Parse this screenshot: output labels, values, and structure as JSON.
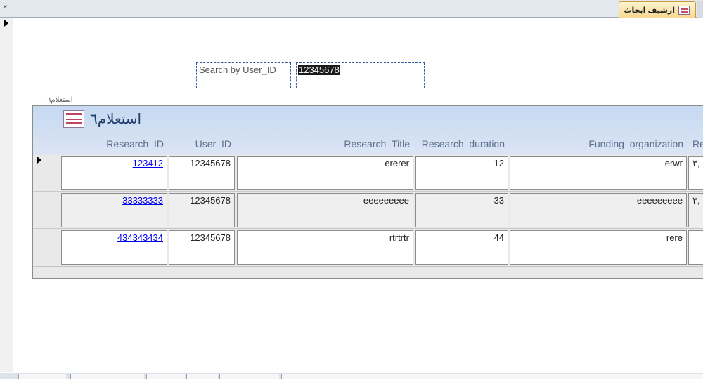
{
  "window": {
    "close_glyph": "×",
    "tab_title": "ارشيف ابحاث"
  },
  "search": {
    "label": "Search by User_ID",
    "value": "12345678"
  },
  "subform": {
    "caption": "استعلام٦",
    "title": "استعلام٦",
    "columns": {
      "research_id": "Research_ID",
      "user_id": "User_ID",
      "research_title": "Research_Title",
      "research_duration": "Research_duration",
      "funding_organization": "Funding_organization",
      "next": "Re"
    },
    "rows": [
      {
        "research_id": "123412",
        "user_id": "12345678",
        "research_title": "ererer",
        "research_duration": "12",
        "funding_organization": "erwr",
        "next": "٣,"
      },
      {
        "research_id": "33333333",
        "user_id": "12345678",
        "research_title": "eeeeeeeee",
        "research_duration": "33",
        "funding_organization": "eeeeeeeee",
        "next": "٣,"
      },
      {
        "research_id": "434343434",
        "user_id": "12345678",
        "research_title": "rtrtrtr",
        "research_duration": "44",
        "funding_organization": "rere",
        "next": ""
      }
    ]
  },
  "icons": {
    "tab": "form-icon",
    "title": "form-icon",
    "record_selector": "current-record-arrow-icon"
  }
}
